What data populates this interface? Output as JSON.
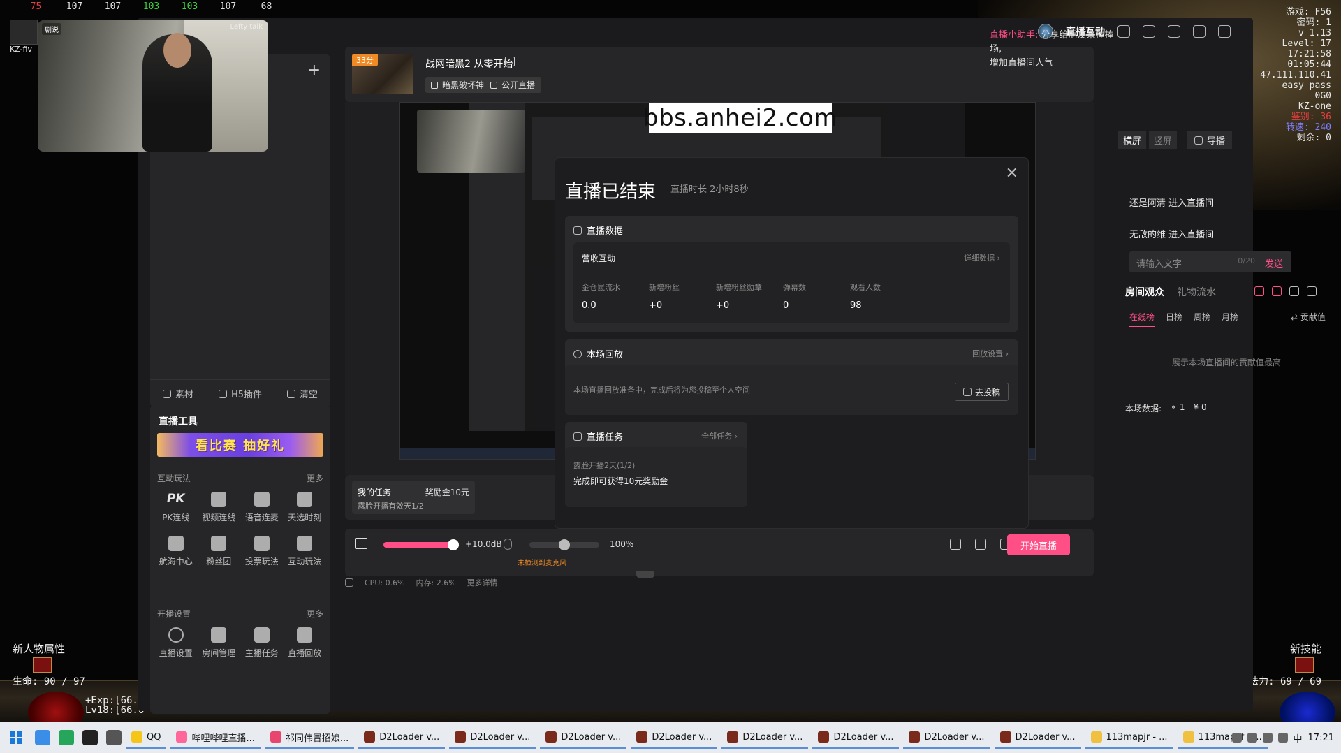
{
  "game": {
    "fps_values": [
      "75",
      "107",
      "107",
      "103",
      "103",
      "107",
      "68"
    ],
    "stats_lines": [
      "游戏: F56",
      "密码: 1",
      "v 1.13",
      "Level: 17",
      "17:21:58",
      "01:05:44",
      "47.111.110.41",
      "easy pass",
      "0G0",
      "KZ-one"
    ],
    "stats_red": "鉴别: 36",
    "stats_blue": "转速: 240",
    "stats_remain": "剩余: 0",
    "kz_label": "KZ-fiv",
    "left_panel_label": "新人物属性",
    "right_panel_label": "新技能",
    "life": "生命: 90 / 97",
    "mana": "法力: 69 / 69",
    "exp_line1": "+Exp:[66.",
    "exp_line2": "Lv18:[66.6"
  },
  "camera": {
    "logo": "剧说",
    "tag": "Lefty talk"
  },
  "titlebar": {
    "title": "直播互动"
  },
  "scene_panel": {
    "footer": [
      {
        "label": "素材",
        "icon": "plus-square-icon"
      },
      {
        "label": "H5插件",
        "icon": "cube-icon"
      },
      {
        "label": "清空",
        "icon": "trash-icon"
      }
    ]
  },
  "tools": {
    "title": "直播工具",
    "banner": "看比赛 抽好礼",
    "interactive": {
      "heading": "互动玩法",
      "more": "更多",
      "items": [
        {
          "label": "PK连线",
          "icon": "pk-icon"
        },
        {
          "label": "视频连线",
          "icon": "users-icon"
        },
        {
          "label": "语音连麦",
          "icon": "mic-icon"
        },
        {
          "label": "天选时刻",
          "icon": "gift-icon"
        },
        {
          "label": "航海中心",
          "icon": "anchor-icon"
        },
        {
          "label": "粉丝团",
          "icon": "heart-icon"
        },
        {
          "label": "投票玩法",
          "icon": "vote-icon"
        },
        {
          "label": "互动玩法",
          "icon": "person-icon"
        }
      ]
    },
    "broadcast": {
      "heading": "开播设置",
      "more": "更多",
      "items": [
        {
          "label": "直播设置",
          "icon": "settings-icon"
        },
        {
          "label": "房间管理",
          "icon": "home-settings-icon"
        },
        {
          "label": "主播任务",
          "icon": "task-icon"
        },
        {
          "label": "直播回放",
          "icon": "replay-icon"
        }
      ]
    }
  },
  "live_info": {
    "thumb_badge": "33分",
    "title": "战网暗黑2 从零开始",
    "chips": [
      "暗黑破坏神",
      "公开直播"
    ]
  },
  "preview": {
    "watermark": "bbs.anhei2.com",
    "view_modes": [
      "横屏",
      "竖屏"
    ],
    "guide_label": "导播"
  },
  "modal": {
    "title": "直播已结束",
    "duration": "直播时长  2小时8秒",
    "live_data": {
      "heading": "直播数据",
      "sub_heading": "营收互动",
      "detail_link": "详细数据",
      "stats": [
        {
          "label": "金仓鼠流水",
          "value": "0.0"
        },
        {
          "label": "新增粉丝",
          "value": "+0"
        },
        {
          "label": "新增粉丝勋章",
          "value": "+0"
        },
        {
          "label": "弹幕数",
          "value": "0"
        },
        {
          "label": "观看人数",
          "value": "98"
        }
      ]
    },
    "replay": {
      "heading": "本场回放",
      "settings_link": "回放设置",
      "desc": "本场直播回放准备中，完成后将为您投稿至个人空间",
      "upload_button": "去投稿"
    },
    "tasks": {
      "heading": "直播任务",
      "all_link": "全部任务",
      "progress": "露脸开播2天(1/2)",
      "reward": "完成即可获得10元奖励金"
    }
  },
  "chat": {
    "assistant_prefix": "直播小助手:",
    "assistant_text": "分享给朋友来捧捧场,",
    "assistant_text2": "增加直播间人气",
    "enters": [
      "还是阿清 进入直播间",
      "无敌的维 进入直播间"
    ],
    "input_placeholder": "请输入文字",
    "input_count": "0/20",
    "send": "发送"
  },
  "audience": {
    "tabs": [
      "房间观众",
      "礼物流水"
    ],
    "rank_tabs": [
      "在线榜",
      "日榜",
      "周榜",
      "月榜"
    ],
    "contribution": "贡献值",
    "empty": "展示本场直播间的贡献值最高",
    "stats_label": "本场数据:",
    "stats_people": "1",
    "stats_money": "0"
  },
  "task_panel": {
    "title": "我的任务",
    "reward": "奖励金10元",
    "desc": "露脸开播有效天1/2"
  },
  "controls": {
    "volume_db": "+10.0dB",
    "volume_level": 1.0,
    "mic_pct": "100%",
    "mic_level": 0.5,
    "mic_warning": "未检测到麦克风",
    "start_button": "开始直播"
  },
  "status": {
    "cpu": "CPU: 0.6%",
    "mem": "内存: 2.6%",
    "more": "更多详情"
  },
  "taskbar": {
    "tasks": [
      {
        "label": "QQ",
        "color": "#f5c518"
      },
      {
        "label": "哔哩哔哩直播...",
        "color": "#ff6699"
      },
      {
        "label": "祁同伟冒招娘...",
        "color": "#e8466e"
      },
      {
        "label": "D2Loader v...",
        "color": "#7a2a1a"
      },
      {
        "label": "D2Loader v...",
        "color": "#7a2a1a"
      },
      {
        "label": "D2Loader v...",
        "color": "#7a2a1a"
      },
      {
        "label": "D2Loader v...",
        "color": "#7a2a1a"
      },
      {
        "label": "D2Loader v...",
        "color": "#7a2a1a"
      },
      {
        "label": "D2Loader v...",
        "color": "#7a2a1a"
      },
      {
        "label": "D2Loader v...",
        "color": "#7a2a1a"
      },
      {
        "label": "D2Loader v...",
        "color": "#7a2a1a"
      },
      {
        "label": "113mapjr - ...",
        "color": "#f0c040"
      },
      {
        "label": "113mapkf - ...",
        "color": "#f0c040"
      }
    ],
    "ime": "中",
    "time": "17:21"
  }
}
